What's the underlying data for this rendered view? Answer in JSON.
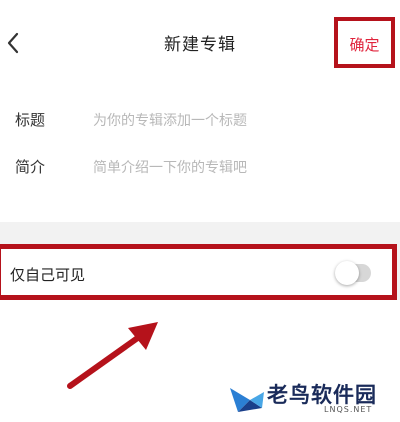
{
  "header": {
    "back_icon": "chevron-left-icon",
    "title": "新建专辑",
    "confirm_label": "确定"
  },
  "form": {
    "title_field": {
      "label": "标题",
      "placeholder": "为你的专辑添加一个标题"
    },
    "intro_field": {
      "label": "简介",
      "placeholder": "简单介绍一下你的专辑吧"
    }
  },
  "visibility": {
    "label": "仅自己可见",
    "enabled": false
  },
  "watermark": {
    "brand": "老鸟软件园",
    "domain": "LNQS.NET"
  },
  "colors": {
    "accent": "#e0243c",
    "highlight_border": "#b5121b",
    "background": "#f2f2f2"
  }
}
